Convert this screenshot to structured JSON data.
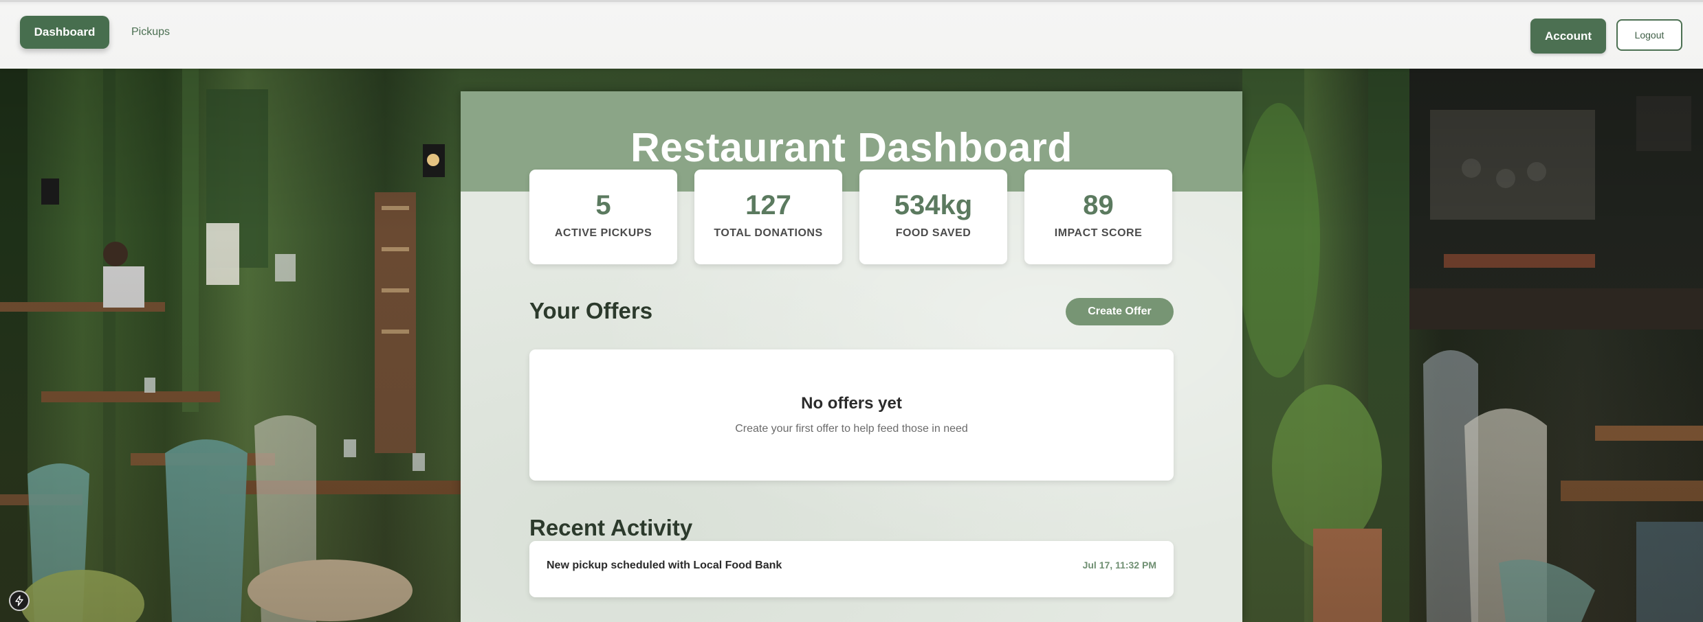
{
  "nav": {
    "dashboard_label": "Dashboard",
    "pickups_label": "Pickups",
    "account_label": "Account",
    "logout_label": "Logout"
  },
  "page": {
    "title": "Restaurant Dashboard"
  },
  "stats": [
    {
      "value": "5",
      "label": "ACTIVE PICKUPS"
    },
    {
      "value": "127",
      "label": "TOTAL DONATIONS"
    },
    {
      "value": "534kg",
      "label": "FOOD SAVED"
    },
    {
      "value": "89",
      "label": "IMPACT SCORE"
    }
  ],
  "offers": {
    "title": "Your Offers",
    "create_label": "Create Offer",
    "empty_title": "No offers yet",
    "empty_subtitle": "Create your first offer to help feed those in need"
  },
  "activity": {
    "title": "Recent Activity",
    "items": [
      {
        "text": "New pickup scheduled with Local Food Bank",
        "time": "Jul 17, 11:32 PM"
      }
    ]
  },
  "colors": {
    "primary": "#476e4e",
    "header_band": "#8ba587",
    "accent_button": "#779574",
    "stat_value": "#5b7a5f"
  },
  "icons": {
    "corner_badge": "lightning-icon"
  }
}
